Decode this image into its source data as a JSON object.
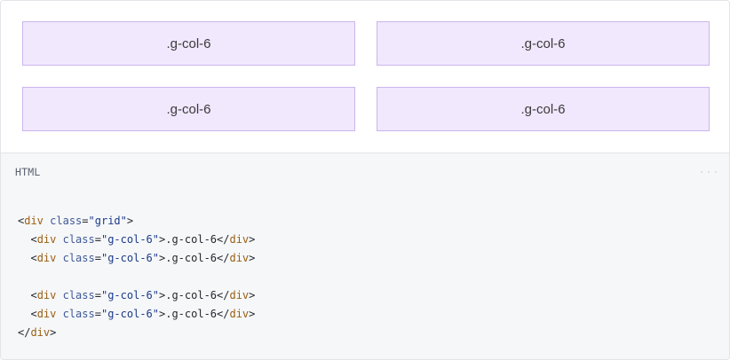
{
  "example": {
    "cells": [
      ".g-col-6",
      ".g-col-6",
      ".g-col-6",
      ".g-col-6"
    ]
  },
  "code_header": {
    "language": "HTML"
  },
  "code": {
    "lines": [
      {
        "indent": "",
        "open": "<",
        "tag": "div",
        "attr": "class",
        "eq": "=",
        "value": "\"grid\"",
        "close": ">",
        "text": "",
        "end_open": "",
        "end_tag": "",
        "end_close": ""
      },
      {
        "indent": "  ",
        "open": "<",
        "tag": "div",
        "attr": "class",
        "eq": "=",
        "value": "\"g-col-6\"",
        "close": ">",
        "text": ".g-col-6",
        "end_open": "</",
        "end_tag": "div",
        "end_close": ">"
      },
      {
        "indent": "  ",
        "open": "<",
        "tag": "div",
        "attr": "class",
        "eq": "=",
        "value": "\"g-col-6\"",
        "close": ">",
        "text": ".g-col-6",
        "end_open": "</",
        "end_tag": "div",
        "end_close": ">"
      },
      {
        "indent": "",
        "open": "",
        "tag": "",
        "attr": "",
        "eq": "",
        "value": "",
        "close": "",
        "text": "",
        "end_open": "",
        "end_tag": "",
        "end_close": ""
      },
      {
        "indent": "  ",
        "open": "<",
        "tag": "div",
        "attr": "class",
        "eq": "=",
        "value": "\"g-col-6\"",
        "close": ">",
        "text": ".g-col-6",
        "end_open": "</",
        "end_tag": "div",
        "end_close": ">"
      },
      {
        "indent": "  ",
        "open": "<",
        "tag": "div",
        "attr": "class",
        "eq": "=",
        "value": "\"g-col-6\"",
        "close": ">",
        "text": ".g-col-6",
        "end_open": "</",
        "end_tag": "div",
        "end_close": ">"
      },
      {
        "indent": "",
        "open": "",
        "tag": "",
        "attr": "",
        "eq": "",
        "value": "",
        "close": "",
        "text": "",
        "end_open": "</",
        "end_tag": "div",
        "end_close": ">"
      }
    ]
  }
}
